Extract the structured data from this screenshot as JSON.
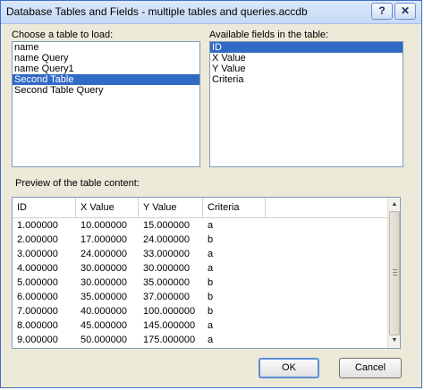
{
  "window": {
    "title": "Database Tables and Fields - multiple tables and queries.accdb",
    "help_label": "?",
    "close_label": "✕"
  },
  "tables": {
    "label": "Choose a table to load:",
    "items": [
      "name",
      "name Query",
      "name Query1",
      "Second Table",
      "Second Table Query"
    ],
    "selected": "Second Table"
  },
  "fields": {
    "label": "Available fields in the table:",
    "items": [
      "ID",
      "X Value",
      "Y Value",
      "Criteria"
    ],
    "selected": "ID"
  },
  "preview": {
    "label": "Preview of the table content:",
    "columns": [
      "ID",
      "X Value",
      "Y Value",
      "Criteria",
      ""
    ],
    "rows": [
      [
        "1.000000",
        "10.000000",
        "15.000000",
        "a"
      ],
      [
        "2.000000",
        "17.000000",
        "24.000000",
        "b"
      ],
      [
        "3.000000",
        "24.000000",
        "33.000000",
        "a"
      ],
      [
        "4.000000",
        "30.000000",
        "30.000000",
        "a"
      ],
      [
        "5.000000",
        "30.000000",
        "35.000000",
        "b"
      ],
      [
        "6.000000",
        "35.000000",
        "37.000000",
        "b"
      ],
      [
        "7.000000",
        "40.000000",
        "100.000000",
        "b"
      ],
      [
        "8.000000",
        "45.000000",
        "145.000000",
        "a"
      ],
      [
        "9.000000",
        "50.000000",
        "175.000000",
        "a"
      ]
    ],
    "scroll_up": "▲",
    "scroll_down": "▼"
  },
  "buttons": {
    "ok": "OK",
    "cancel": "Cancel"
  }
}
